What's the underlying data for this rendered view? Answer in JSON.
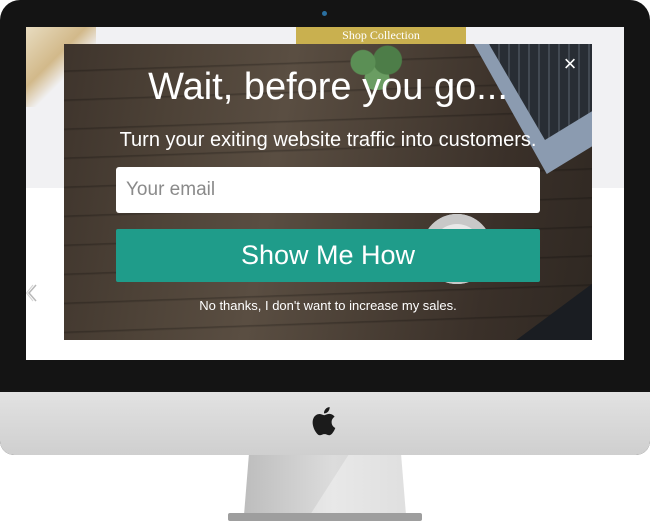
{
  "site": {
    "banner_label": "Shop Collection"
  },
  "popup": {
    "title": "Wait, before you go...",
    "subtitle": "Turn your exiting website traffic into customers.",
    "email_placeholder": "Your email",
    "email_value": "",
    "cta_label": "Show Me How",
    "decline_label": "No thanks, I don't want to increase my sales.",
    "close_symbol": "×"
  },
  "icons": {
    "close": "close-icon",
    "carousel_prev": "chevron-left-icon",
    "brand": "apple-logo-icon"
  },
  "colors": {
    "accent": "#1f9c8a",
    "banner": "#c9b04f",
    "bezel": "#141414",
    "chin": "#d9d9d9"
  },
  "carousel": {
    "prev_symbol": "《"
  }
}
